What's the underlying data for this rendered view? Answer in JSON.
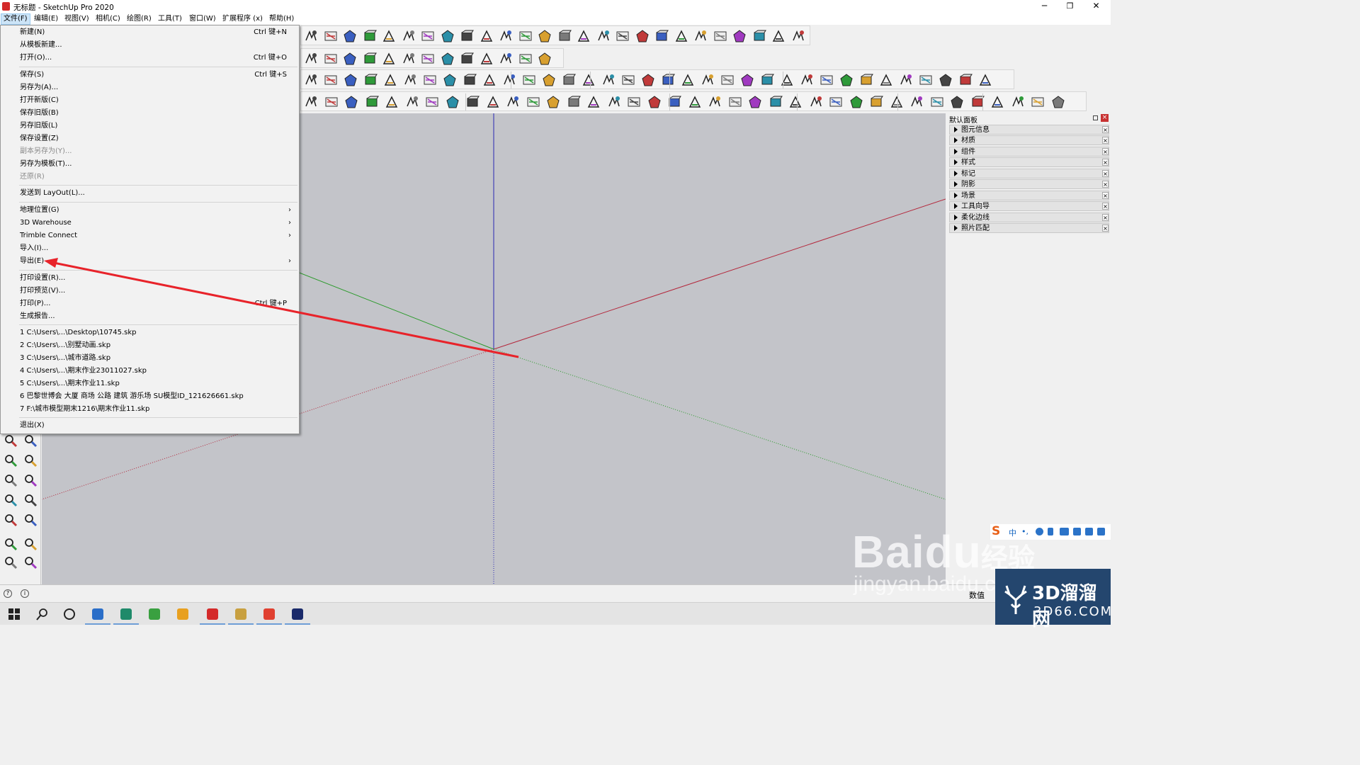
{
  "window": {
    "title": "无标题 - SketchUp Pro 2020",
    "minimize": "─",
    "maximize": "❐",
    "close": "✕"
  },
  "menubar": [
    {
      "label": "文件(F)",
      "active": true
    },
    {
      "label": "编辑(E)"
    },
    {
      "label": "视图(V)"
    },
    {
      "label": "相机(C)"
    },
    {
      "label": "绘图(R)"
    },
    {
      "label": "工具(T)"
    },
    {
      "label": "窗口(W)"
    },
    {
      "label": "扩展程序 (x)"
    },
    {
      "label": "帮助(H)"
    }
  ],
  "file_menu": {
    "items": [
      {
        "label": "新建(N)",
        "shortcut": "Ctrl 键+N"
      },
      {
        "label": "从模板新建..."
      },
      {
        "label": "打开(O)...",
        "shortcut": "Ctrl 键+O"
      },
      {
        "label": "保存(S)",
        "shortcut": "Ctrl 键+S"
      },
      {
        "label": "另存为(A)..."
      },
      {
        "label": "打开新版(C)"
      },
      {
        "label": "保存旧版(B)"
      },
      {
        "label": "另存旧版(L)"
      },
      {
        "label": "保存设置(Z)"
      },
      {
        "label": "副本另存为(Y)...",
        "disabled": true
      },
      {
        "label": "另存为模板(T)..."
      },
      {
        "label": "还原(R)",
        "disabled": true
      },
      {
        "label": "发送到 LayOut(L)..."
      },
      {
        "label": "地理位置(G)",
        "submenu": "›"
      },
      {
        "label": "3D Warehouse",
        "submenu": "›"
      },
      {
        "label": "Trimble Connect",
        "submenu": "›"
      },
      {
        "label": "导入(I)..."
      },
      {
        "label": "导出(E)",
        "submenu": "›"
      },
      {
        "label": "打印设置(R)..."
      },
      {
        "label": "打印预览(V)..."
      },
      {
        "label": "打印(P)...",
        "shortcut": "Ctrl 键+P"
      },
      {
        "label": "生成报告..."
      },
      {
        "label": "1 C:\\Users\\...\\Desktop\\10745.skp"
      },
      {
        "label": "2 C:\\Users\\...\\别墅动画.skp"
      },
      {
        "label": "3 C:\\Users\\...\\城市道路.skp"
      },
      {
        "label": "4 C:\\Users\\...\\期末作业23011027.skp"
      },
      {
        "label": "5 C:\\Users\\...\\期末作业11.skp"
      },
      {
        "label": "6 巴黎世博会 大厦 商场 公路 建筑 游乐场 SU模型ID_121626661.skp"
      },
      {
        "label": "7 F:\\城市模型期末1216\\期末作业11.skp"
      },
      {
        "label": "退出(X)"
      }
    ]
  },
  "tray": {
    "title": "默认面板",
    "pin": "",
    "close": "×",
    "panels": [
      "图元信息",
      "材质",
      "组件",
      "样式",
      "标记",
      "阴影",
      "场景",
      "工具向导",
      "柔化边线",
      "照片匹配"
    ]
  },
  "statusbar": {
    "measurements_label": "数值",
    "info1": "?",
    "info2": "i"
  },
  "ime": {
    "logo": "S",
    "mode": "中",
    "punct": "•,"
  },
  "watermarks": {
    "baidu": "Baidu",
    "jingyan": "经验",
    "url": "jingyan.baidu.com",
    "site_cn": "3D溜溜网",
    "site_url": "3D66.COM"
  },
  "colors": {
    "accent_red": "#e8232a",
    "axis_red": "#b4283c",
    "axis_green": "#2a9a2a",
    "axis_blue": "#2828b4",
    "menu_highlight": "#cce4f7",
    "viewport_bg": "#c3c4c9"
  },
  "taskbar_icons": [
    "windows-icon",
    "search-icon",
    "task-view-icon",
    "computer-icon",
    "ai-icon",
    "browser-icon",
    "weather-icon",
    "sketchup-icon",
    "filemanager-icon",
    "chrome-icon",
    "photoshop-icon"
  ]
}
